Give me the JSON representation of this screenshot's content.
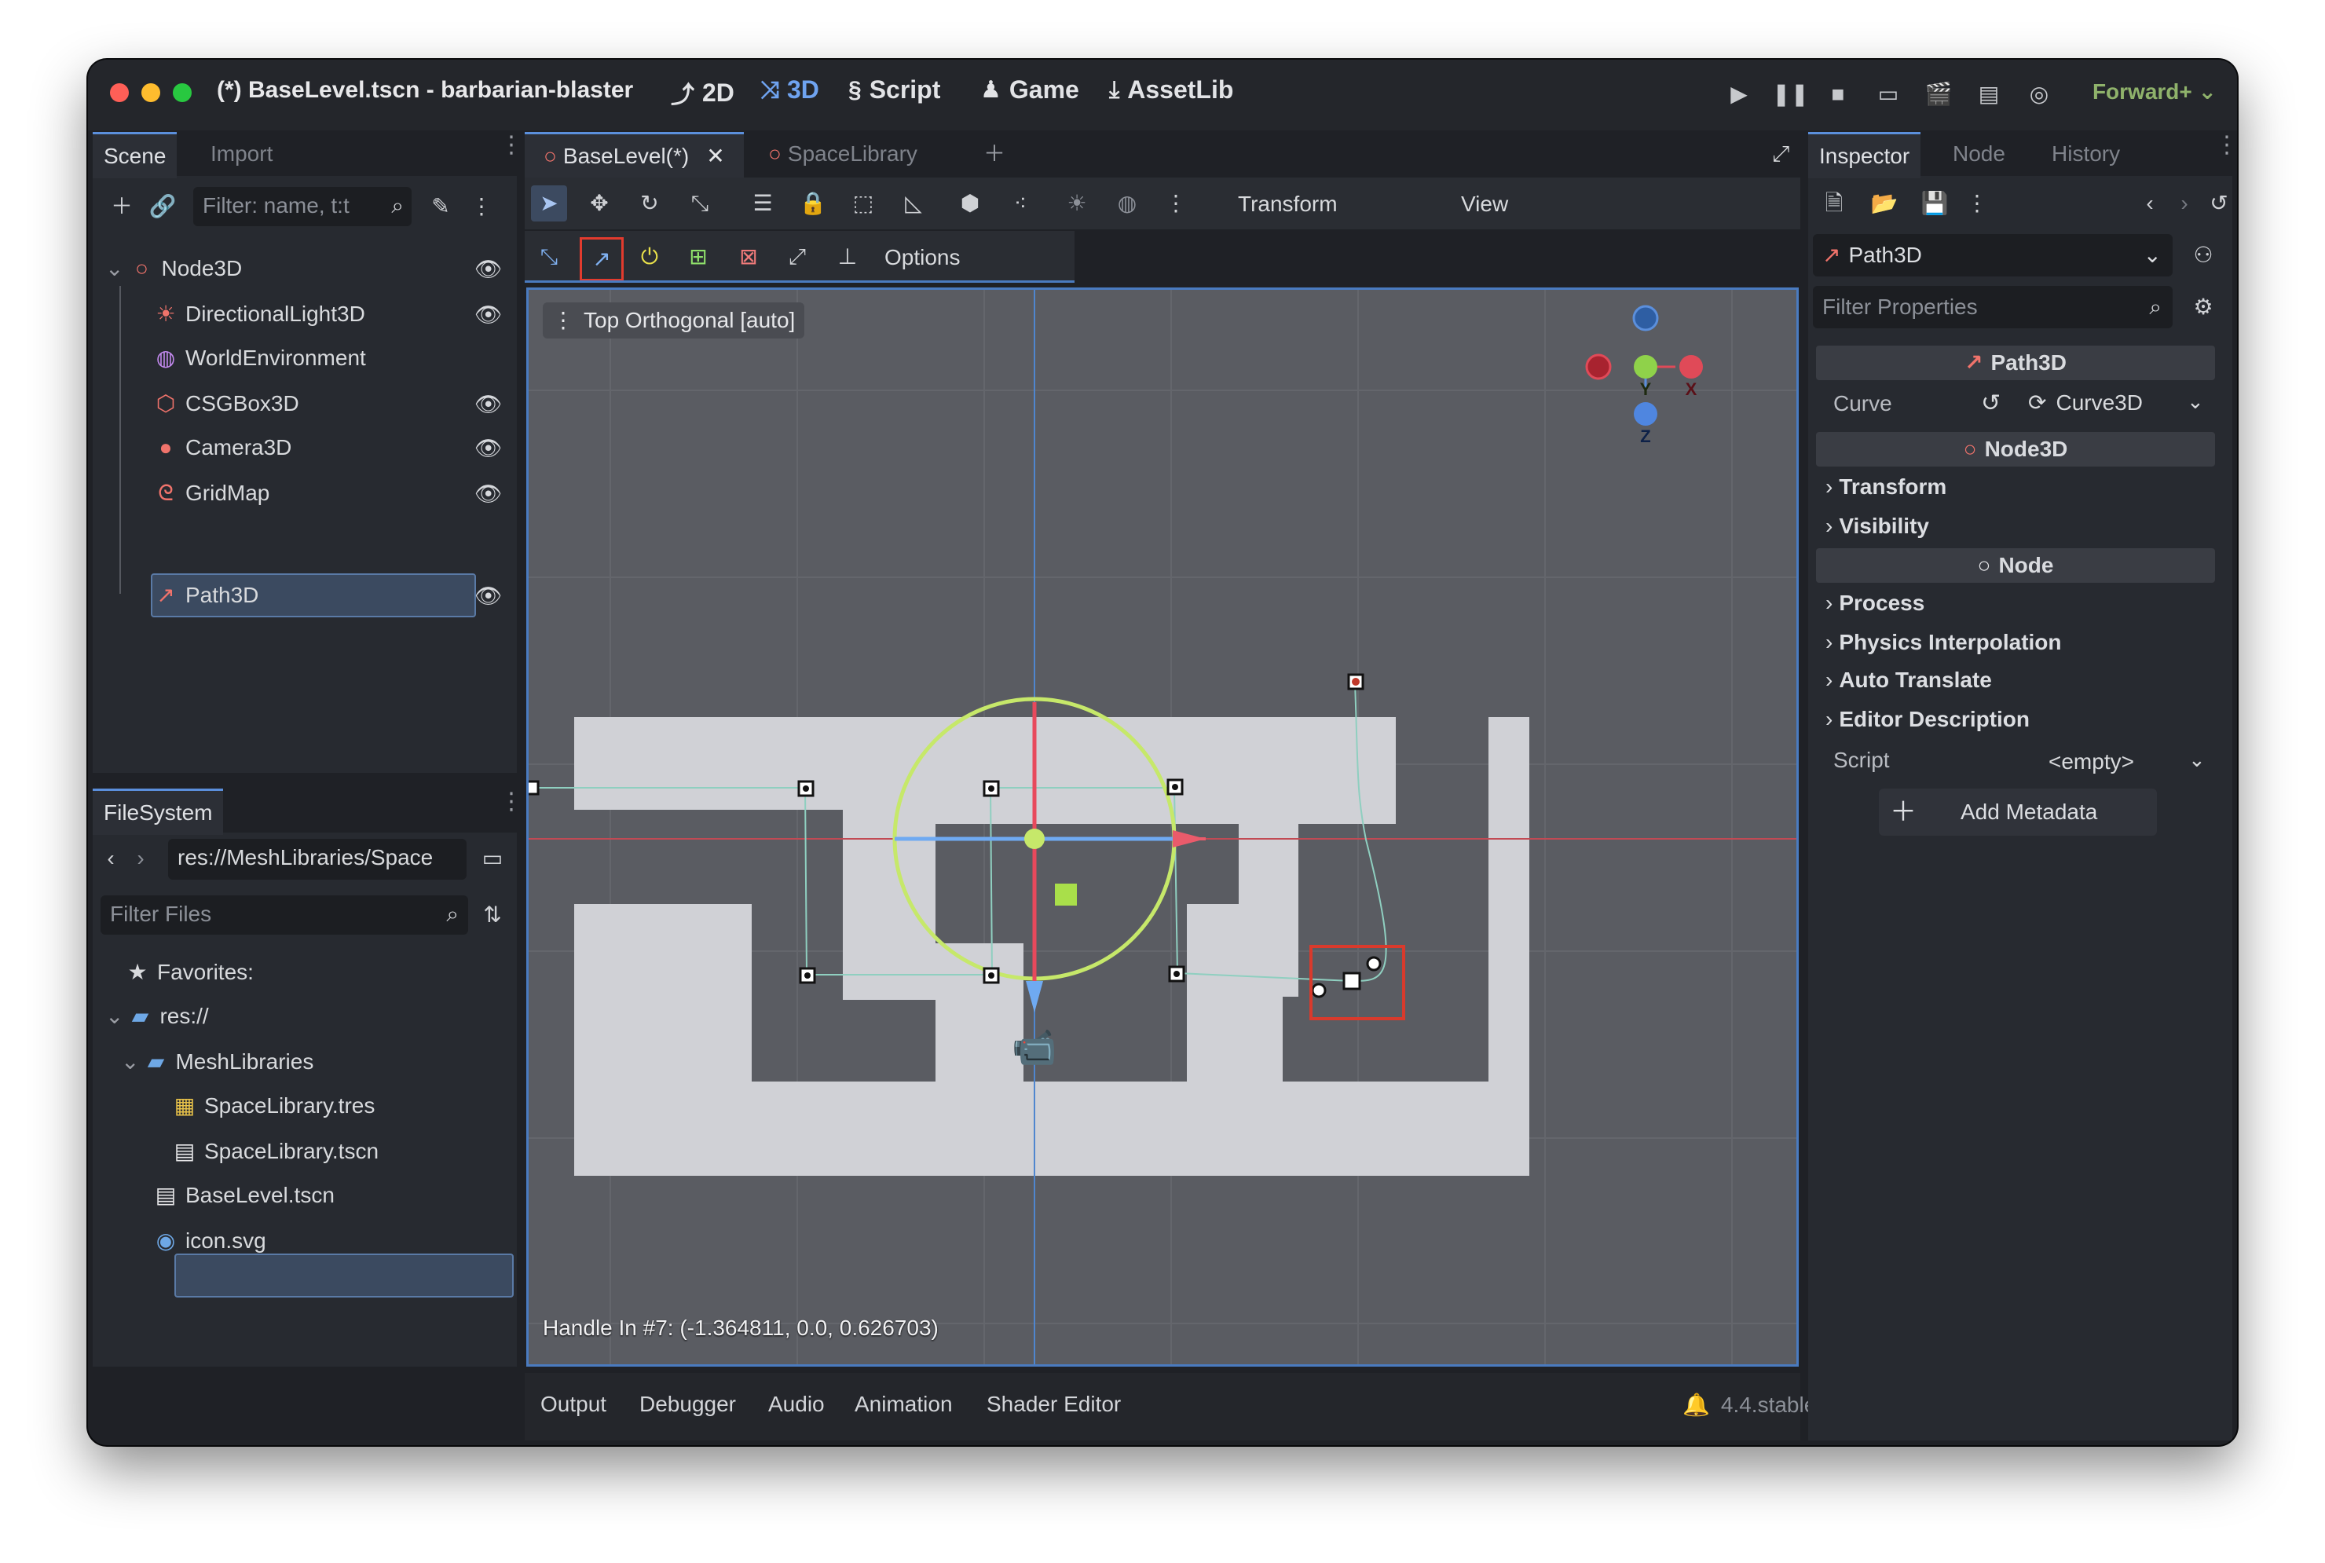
{
  "window": {
    "title": "(*) BaseLevel.tscn - barbarian-blaster",
    "modes": [
      {
        "label": "2D",
        "icon": "2d-mode-icon"
      },
      {
        "label": "3D",
        "icon": "3d-mode-icon"
      },
      {
        "label": "Script",
        "icon": "script-icon"
      },
      {
        "label": "Game",
        "icon": "game-icon"
      },
      {
        "label": "AssetLib",
        "icon": "assetlib-icon"
      }
    ],
    "renderer": "Forward+",
    "colors": {
      "accent": "#5b8fdc",
      "renderer": "#8fb26b",
      "close": "#ff5f57",
      "minimize": "#febc2e",
      "maximize": "#28c840"
    }
  },
  "scene_panel": {
    "tabs": [
      "Scene",
      "Import"
    ],
    "filter_placeholder": "Filter: name, t:t",
    "tree": [
      {
        "label": "Node3D",
        "icon": "node3d-icon",
        "visible_toggle": true
      },
      {
        "label": "DirectionalLight3D",
        "icon": "light-icon",
        "visible_toggle": true
      },
      {
        "label": "WorldEnvironment",
        "icon": "world-env-icon",
        "visible_toggle": false
      },
      {
        "label": "CSGBox3D",
        "icon": "csgbox-icon",
        "visible_toggle": true
      },
      {
        "label": "Camera3D",
        "icon": "camera-icon",
        "visible_toggle": true
      },
      {
        "label": "GridMap",
        "icon": "gridmap-icon",
        "visible_toggle": true
      },
      {
        "label": "Path3D",
        "icon": "path3d-icon",
        "visible_toggle": true,
        "selected": true
      }
    ]
  },
  "filesystem": {
    "tab": "FileSystem",
    "path": "res://MeshLibraries/Space",
    "filter_placeholder": "Filter Files",
    "items": [
      {
        "label": "Favorites:",
        "icon": "star-icon"
      },
      {
        "label": "res://",
        "icon": "folder-icon"
      },
      {
        "label": "MeshLibraries",
        "icon": "folder-icon"
      },
      {
        "label": "SpaceLibrary.tres",
        "icon": "meshlib-icon"
      },
      {
        "label": "SpaceLibrary.tscn",
        "icon": "scene-file-icon",
        "selected": true
      },
      {
        "label": "BaseLevel.tscn",
        "icon": "scene-file-icon"
      },
      {
        "label": "icon.svg",
        "icon": "svg-icon"
      }
    ]
  },
  "editor_tabs": [
    {
      "label": "BaseLevel(*)",
      "active": true
    },
    {
      "label": "SpaceLibrary",
      "active": false
    }
  ],
  "toolbar": {
    "transform_menu": "Transform",
    "view_menu": "View",
    "options_menu": "Options"
  },
  "viewport": {
    "label": "Top Orthogonal [auto]",
    "status": "Handle In #7: (-1.364811, 0.0, 0.626703)",
    "gizmo_axes": [
      "Y",
      "X",
      "Z"
    ]
  },
  "bottom_panel": {
    "tabs": [
      "Output",
      "Debugger",
      "Audio",
      "Animation",
      "Shader Editor"
    ],
    "version": "4.4.stable"
  },
  "inspector": {
    "tabs": [
      "Inspector",
      "Node",
      "History"
    ],
    "node_selector": "Path3D",
    "filter_placeholder": "Filter Properties",
    "sections": {
      "path3d": "Path3D",
      "curve_label": "Curve",
      "curve_value": "Curve3D",
      "node3d": "Node3D",
      "node": "Node"
    },
    "groups_node3d": [
      "Transform",
      "Visibility"
    ],
    "groups_node": [
      "Process",
      "Physics Interpolation",
      "Auto Translate",
      "Editor Description"
    ],
    "script_label": "Script",
    "script_value": "<empty>",
    "add_metadata": "Add Metadata"
  }
}
